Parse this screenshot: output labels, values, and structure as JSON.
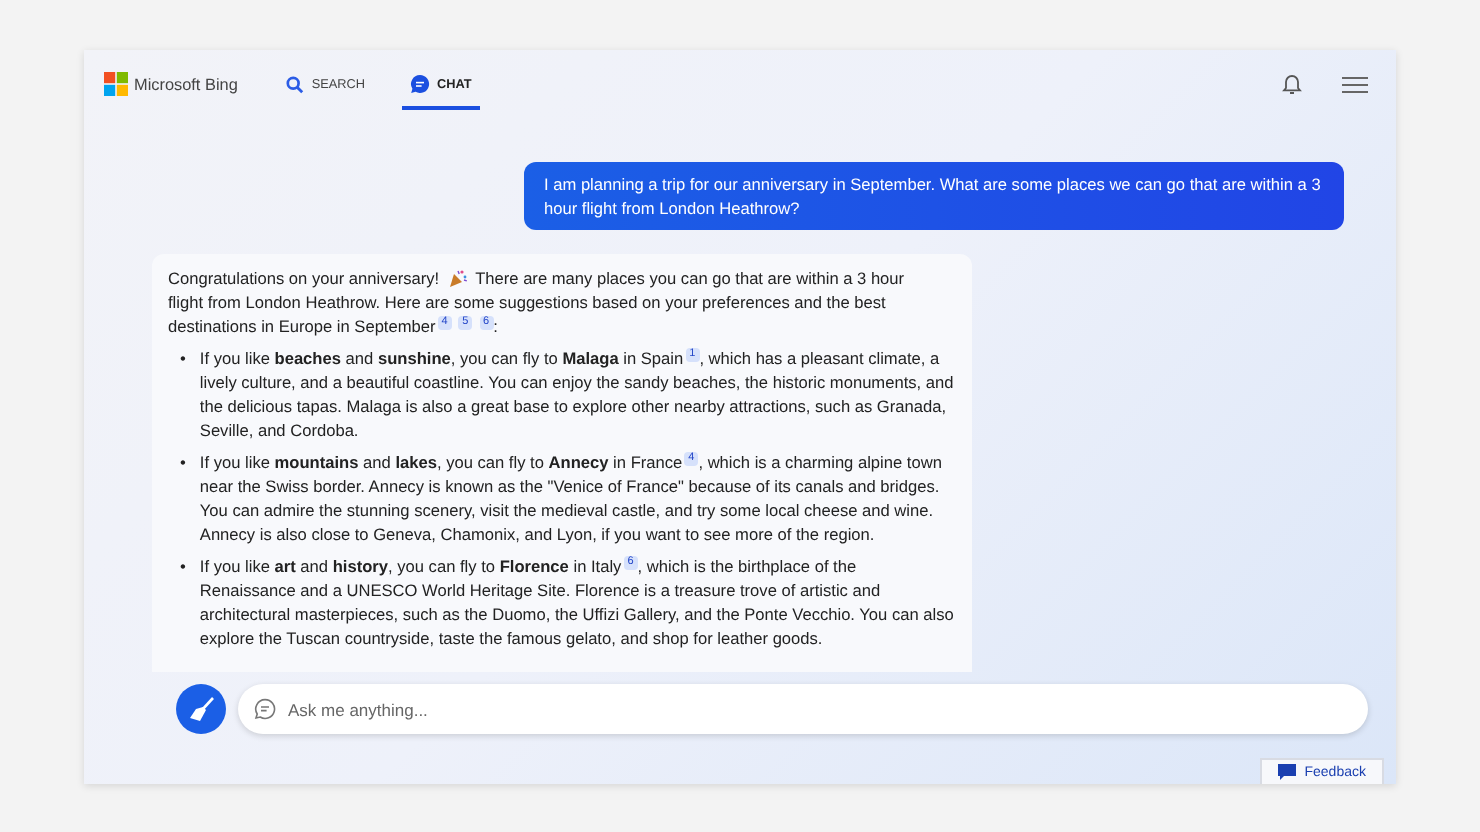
{
  "header": {
    "brand": "Microsoft Bing",
    "tabs": [
      {
        "label": "SEARCH",
        "selected": false
      },
      {
        "label": "CHAT",
        "selected": true
      }
    ]
  },
  "user_message": "I am planning a trip for our anniversary in September. What are some places we can go that are within a 3 hour flight from London Heathrow?",
  "answer": {
    "intro_lead": "Congratulations on your anniversary!",
    "intro_line": "There are many places you can go that are within a 3 hour",
    "intro_rest": "flight from London Heathrow. Here are some suggestions based on your preferences and the best destinations in Europe in September$^{4}$ $^{5}$ $^{6}$:",
    "bullets": [
      {
        "marker": "•",
        "text": "If you like **beaches** and **sunshine**, you can fly to **Malaga** in Spain$^{1}$, which has a pleasant climate, a lively culture, and a beautiful coastline. You can enjoy the sandy beaches, the historic monuments, and the delicious tapas. Malaga is also a great base to explore other nearby attractions, such as Granada, Seville, and Cordoba."
      },
      {
        "marker": "•",
        "text": "If you like **mountains** and **lakes**, you can fly to **Annecy** in France$^{4}$, which is a charming alpine town near the Swiss border. Annecy is known as the \"Venice of France\" because of its canals and bridges. You can admire the stunning scenery, visit the medieval castle, and try some local cheese and wine. Annecy is also close to Geneva, Chamonix, and Lyon, if you want to see more of the region."
      },
      {
        "marker": "•",
        "text": "If you like **art** and **history**, you can fly to **Florence** in Italy$^{6}$, which is the birthplace of the Renaissance and a UNESCO World Heritage Site. Florence is a treasure trove of artistic and architectural masterpieces, such as the Duomo, the Uffizi Gallery, and the Ponte Vecchio. You can also explore the Tuscan countryside, taste the famous gelato, and shop for leather goods."
      }
    ]
  },
  "input": {
    "placeholder": "Ask me anything..."
  },
  "feedback": "Feedback"
}
